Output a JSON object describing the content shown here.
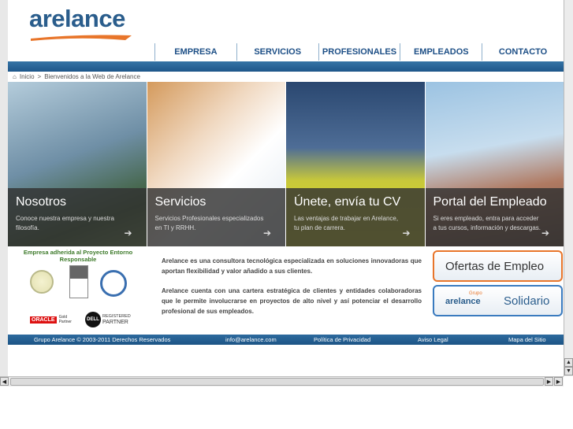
{
  "logo": {
    "text": "arelance"
  },
  "nav": [
    "EMPRESA",
    "SERVICIOS",
    "PROFESIONALES",
    "EMPLEADOS",
    "CONTACTO"
  ],
  "breadcrumb": {
    "home": "Inicio",
    "sep": ">",
    "current": "Bienvenidos a la Web de Arelance"
  },
  "panels": [
    {
      "title": "Nosotros",
      "desc": "Conoce nuestra empresa y nuestra filosofía."
    },
    {
      "title": "Servicios",
      "desc": "Servicios Profesionales especializados en TI y RRHH."
    },
    {
      "title": "Únete, envía tu CV",
      "desc": "Las ventajas de trabajar en Arelance, tu plan de carrera."
    },
    {
      "title": "Portal del Empleado",
      "desc": "Si eres empleado, entra para acceder a tus cursos, información y descargas."
    }
  ],
  "entorno": "Empresa adherida al Proyecto Entorno Responsable",
  "intro": [
    "Arelance es una consultora tecnológica especializada en soluciones innovadoras que aportan flexibilidad y valor añadido a sus clientes.",
    "Arelance cuenta con una cartera estratégica de clientes y entidades colaboradoras que le permite involucrarse en proyectos de alto nivel y así potenciar el desarrollo profesional de sus empleados."
  ],
  "partners": {
    "oracle": "ORACLE",
    "oracle_sub": "Gold Partner",
    "dell": "DELL",
    "dell_sub1": "REGISTERED",
    "dell_sub2": "PARTNER"
  },
  "side": {
    "ofertas": "Ofertas de Empleo",
    "grupo": "Grupo",
    "solidario_logo": "arelance",
    "solidario": "Solidario"
  },
  "footer": {
    "copy": "Grupo Arelance © 2003-2011 Derechos Reservados",
    "email": "info@arelance.com",
    "privacy": "Política de Privacidad",
    "legal": "Aviso Legal",
    "map": "Mapa del Sitio"
  },
  "colors": {
    "brand_blue": "#1d4f86",
    "brand_orange": "#e8752a",
    "footer": "#1d5585"
  }
}
